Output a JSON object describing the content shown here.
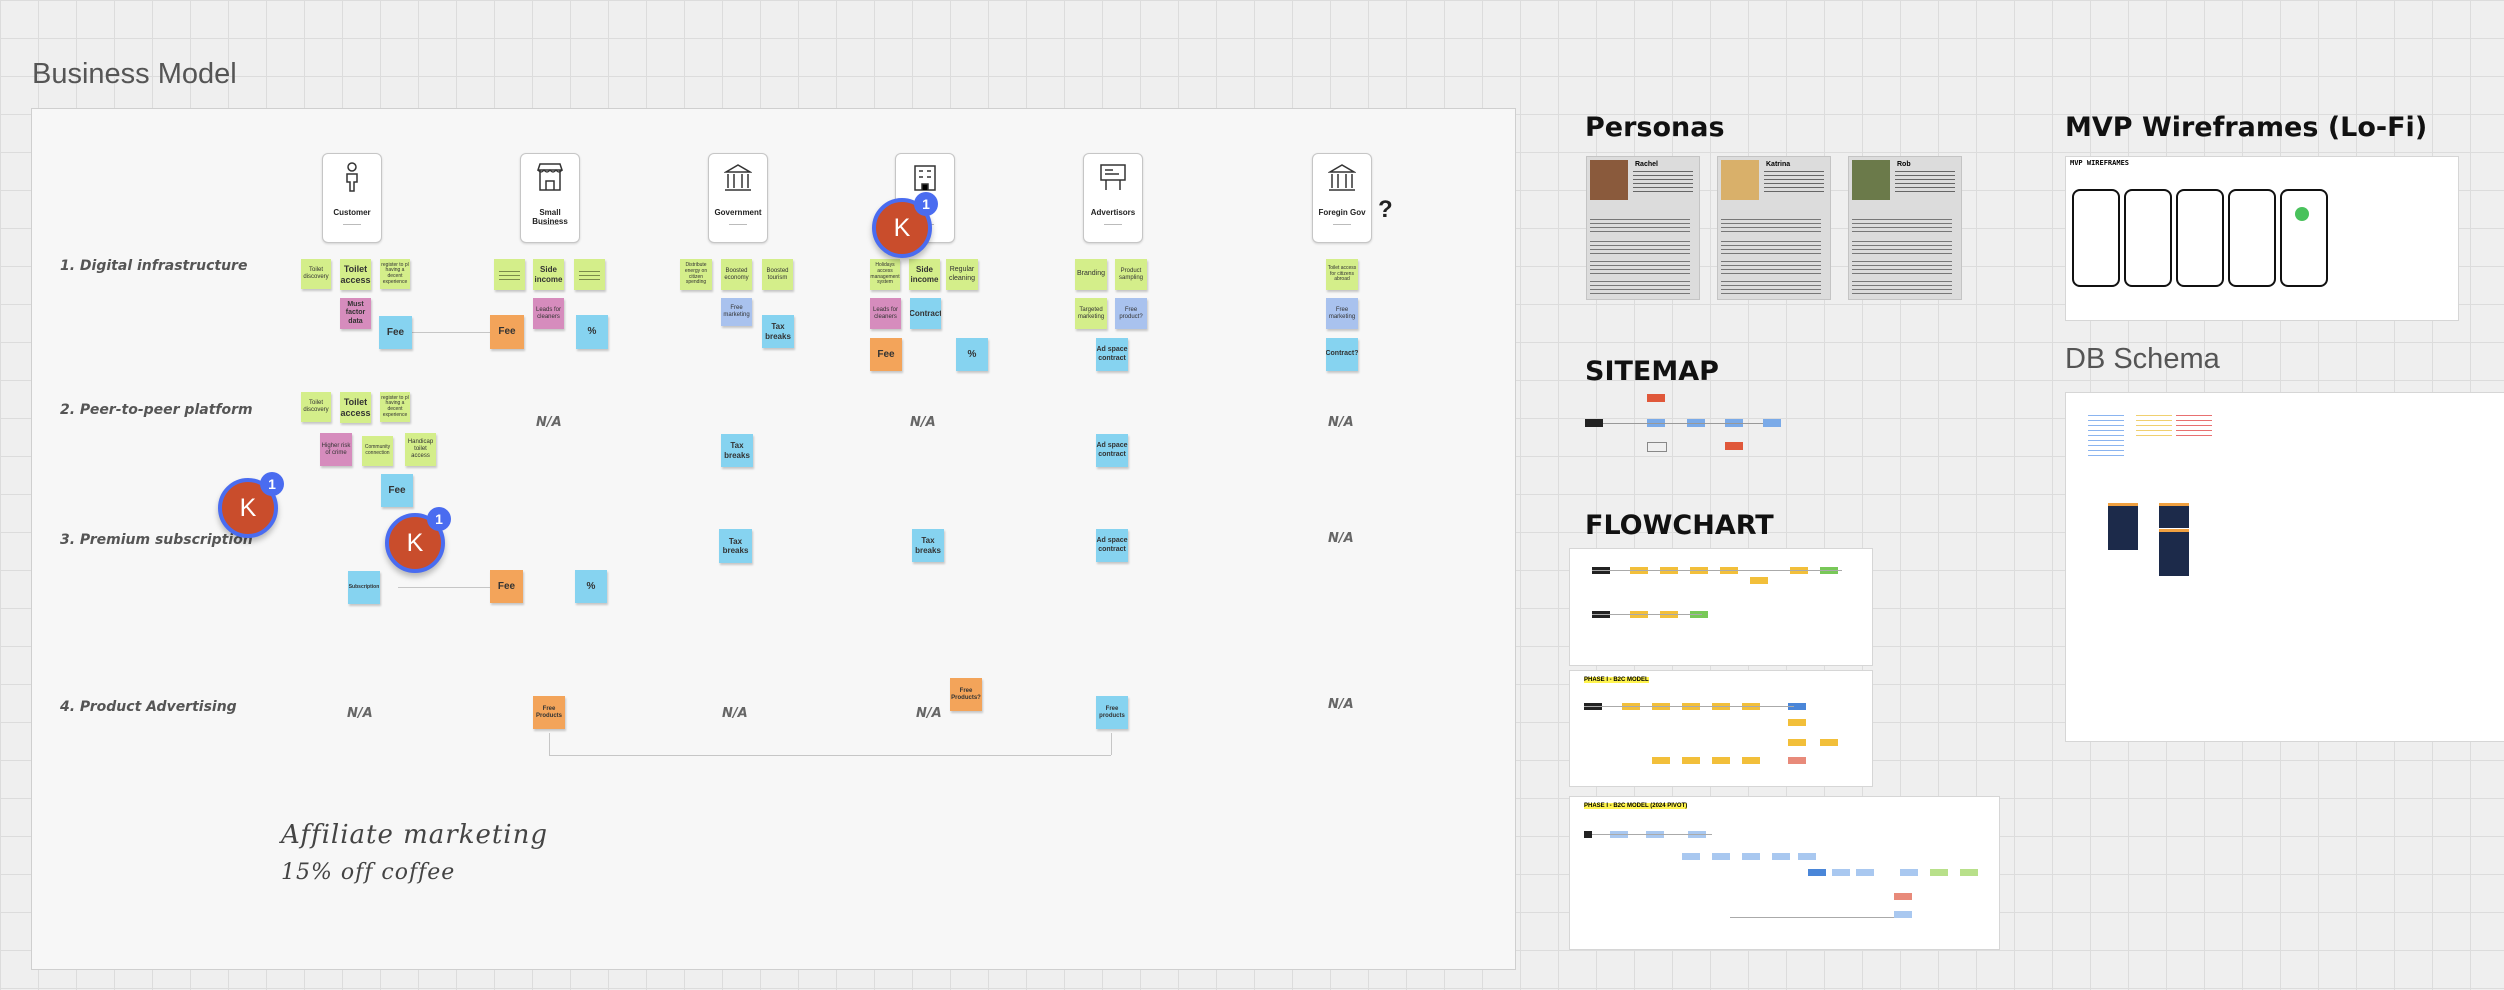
{
  "frames": {
    "business_model": "Business Model",
    "personas": "Personas",
    "mvp_wireframes": "MVP Wireframes (Lo-Fi)",
    "sitemap": "SITEMAP",
    "flowchart": "FLOWCHART",
    "db_schema": "DB Schema"
  },
  "columns": [
    "Customer",
    "Small Business",
    "Government",
    "",
    "Advertisors",
    "Foregin Gov"
  ],
  "question_mark": "?",
  "rows": [
    "1. Digital infrastructure",
    "2. Peer-to-peer platform",
    "3. Premium subscription",
    "4. Product Advertising"
  ],
  "na": "N/A",
  "stickies": {
    "toilet_discovery": "Toilet discovery",
    "toilet_access": "Toilet access",
    "toilet_access_2": "Toilet access",
    "register_toilet": "register to pl having a decent experience",
    "register_toilet_2": "register to pl having a decent experience",
    "must_factor_data": "Must factor data",
    "fee": "Fee",
    "side_income": "Side income",
    "leads_cleaners": "Leads for cleaners",
    "percent": "%",
    "distribute_energy": "Distribute energy on citizen spending",
    "boosted_economy": "Boosted economy",
    "boosted_tourism": "Boosted tourism",
    "free_marketing": "Free marketing",
    "tax_breaks": "Tax breaks",
    "holiday_maps": "Holidays access management system",
    "regular_cleaning": "Regular cleaning",
    "contract": "Contract",
    "branding": "Branding",
    "product_sampling": "Product sampling",
    "targeted_marketing": "Targeted marketing",
    "free_product": "Free product?",
    "ad_space_contract": "Ad space contract",
    "toilet_access_abroad": "Toilet access for citizens abroad",
    "contract_q": "Contract?",
    "higher_risk": "Higher risk of crime",
    "community_connection": "Community connection",
    "handicap_access": "Handicap toilet access",
    "subscription": "Subscription",
    "free_products": "Free Products",
    "free_products_q": "Free Products?",
    "free_products_l": "Free products"
  },
  "avatars": {
    "initial": "K",
    "badge": "1"
  },
  "handwriting": [
    "Affiliate marketing",
    "15% off coffee"
  ],
  "personas": [
    "Rachel",
    "Katrina",
    "Rob"
  ],
  "wireframe_caption": "MVP WIREFRAMES",
  "flowchart_phases": [
    "PHASE I - B2C MODEL",
    "PHASE I - B2C MODEL (2024 PIVOT)"
  ],
  "colors": {
    "lime": "#d4ee8a",
    "pink": "#d68cbd",
    "blue": "#86d3f0",
    "orange": "#f3a45a",
    "lavender": "#a9c2ee",
    "avatar": "#c94d2c",
    "badge": "#4a6cf0"
  }
}
